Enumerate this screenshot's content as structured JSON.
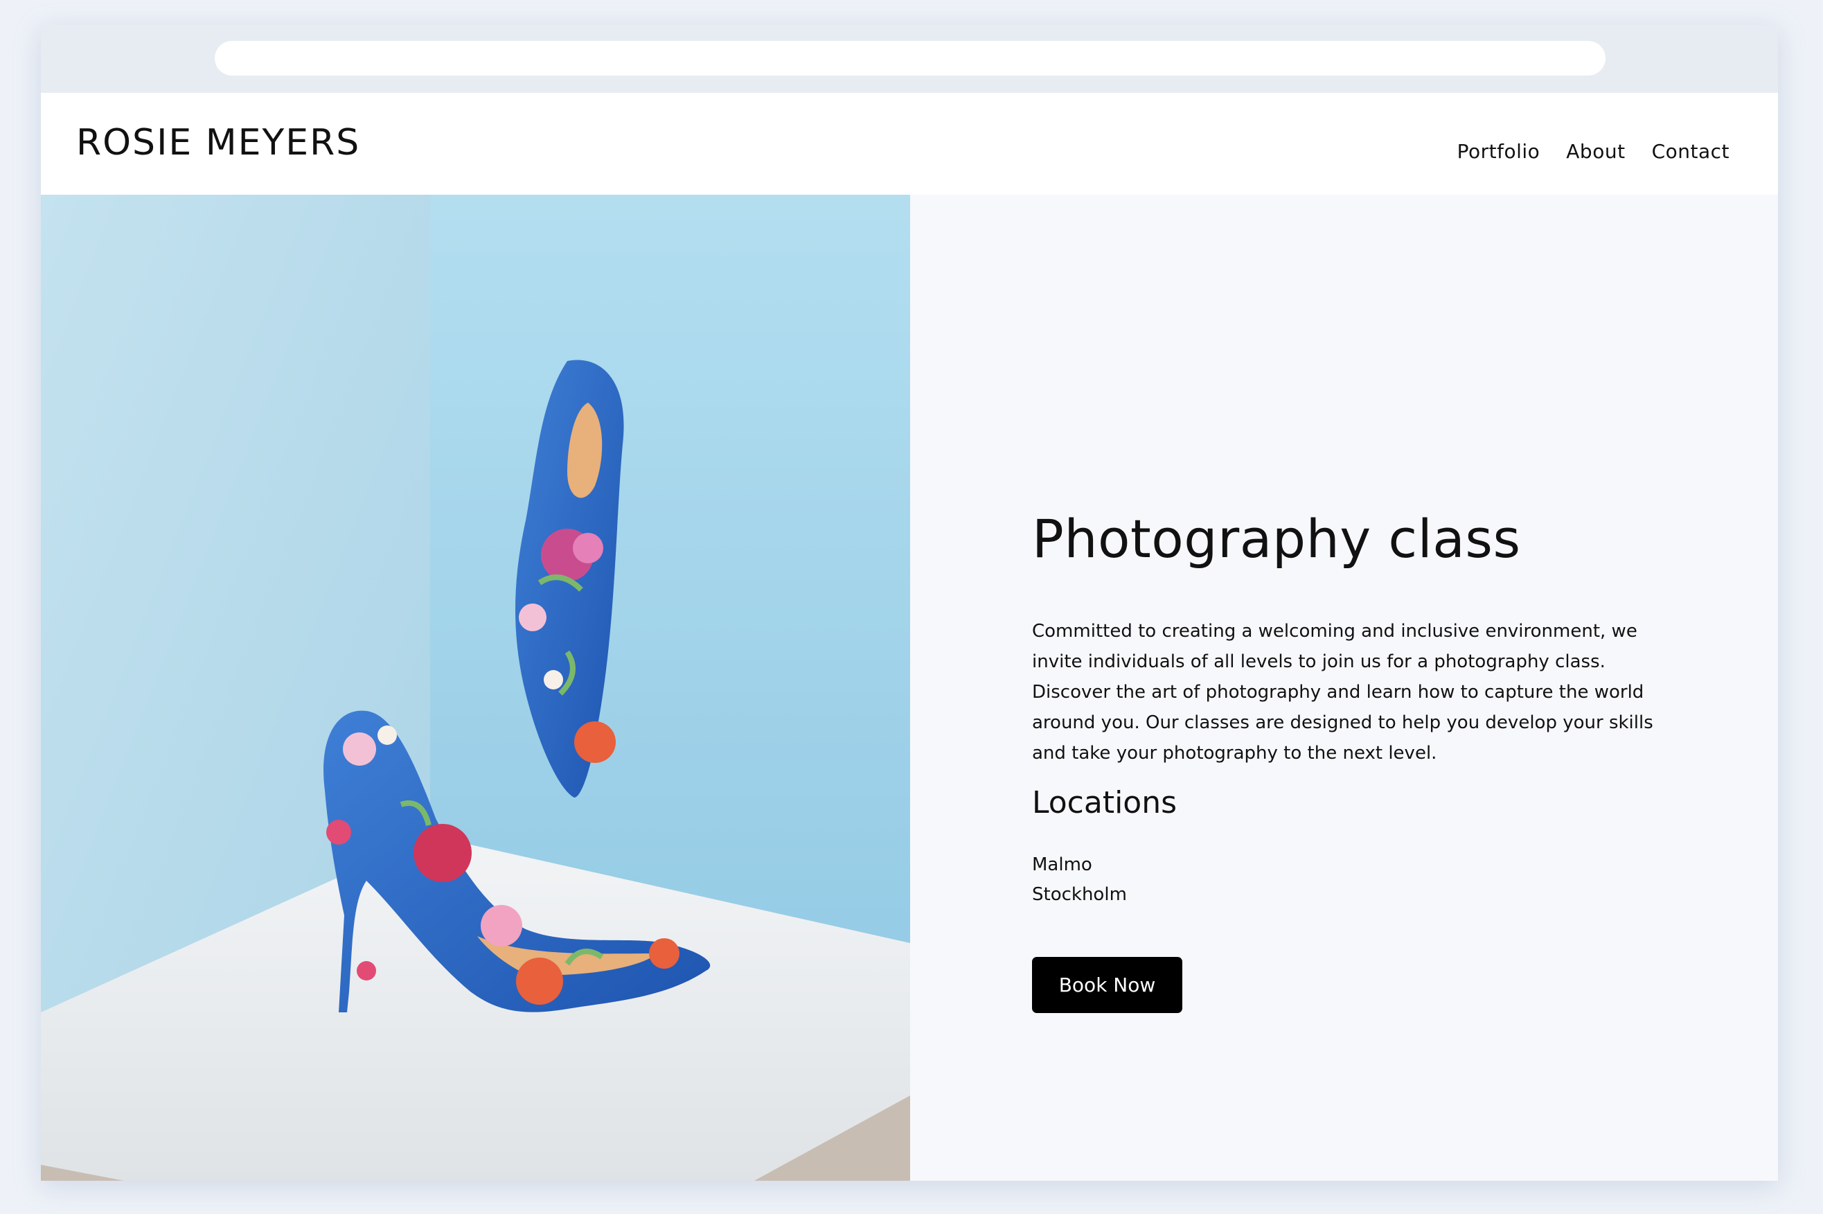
{
  "header": {
    "brand": "ROSIE MEYERS",
    "nav": [
      "Portfolio",
      "About",
      "Contact"
    ]
  },
  "hero": {
    "image_alt": "Two blue floral high-heel shoes against a light blue wall"
  },
  "main": {
    "title": "Photography class",
    "description": "Committed to creating a welcoming and inclusive environment, we invite individuals of all levels to join us for a photography class. Discover the art of photography and learn how to capture the world around you. Our classes are designed to help you develop your skills and take your photography to the next level.",
    "locations_heading": "Locations",
    "locations": [
      "Malmo",
      "Stockholm"
    ],
    "cta_label": "Book Now"
  },
  "colors": {
    "page_bg": "#eef2f8",
    "browser_bar": "#e7ecf3",
    "content_bg": "#f7f8fb",
    "button_bg": "#000000",
    "button_text": "#ffffff"
  }
}
